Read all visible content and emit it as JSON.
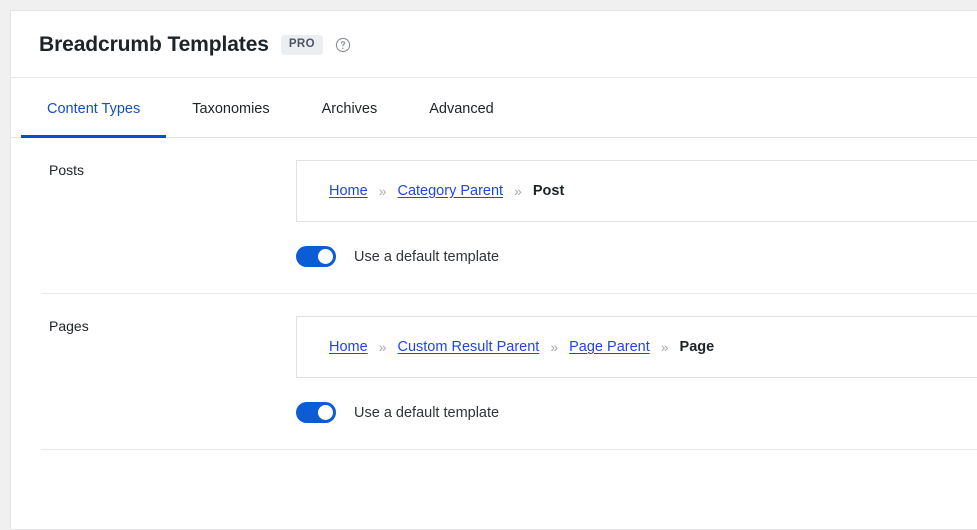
{
  "header": {
    "title": "Breadcrumb Templates",
    "badge": "PRO",
    "help_icon": "help-circle-icon"
  },
  "tabs": [
    {
      "label": "Content Types",
      "active": true
    },
    {
      "label": "Taxonomies",
      "active": false
    },
    {
      "label": "Archives",
      "active": false
    },
    {
      "label": "Advanced",
      "active": false
    }
  ],
  "sections": [
    {
      "label": "Posts",
      "breadcrumb": [
        {
          "text": "Home",
          "type": "link"
        },
        {
          "text": "Category Parent",
          "type": "link"
        },
        {
          "text": "Post",
          "type": "current"
        }
      ],
      "separator": "»",
      "toggle": {
        "label": "Use a default template",
        "on": true
      }
    },
    {
      "label": "Pages",
      "breadcrumb": [
        {
          "text": "Home",
          "type": "link"
        },
        {
          "text": "Custom Result Parent",
          "type": "link"
        },
        {
          "text": "Page Parent",
          "type": "link"
        },
        {
          "text": "Page",
          "type": "current"
        }
      ],
      "separator": "»",
      "toggle": {
        "label": "Use a default template",
        "on": true
      }
    }
  ],
  "colors": {
    "accent": "#0b5cd5",
    "link": "#2145e6",
    "active_tab": "#1250c4",
    "page_background": "#f0f0f1",
    "panel": "#ffffff",
    "badge_background": "#eceff2",
    "separator": "#a7aaad"
  }
}
